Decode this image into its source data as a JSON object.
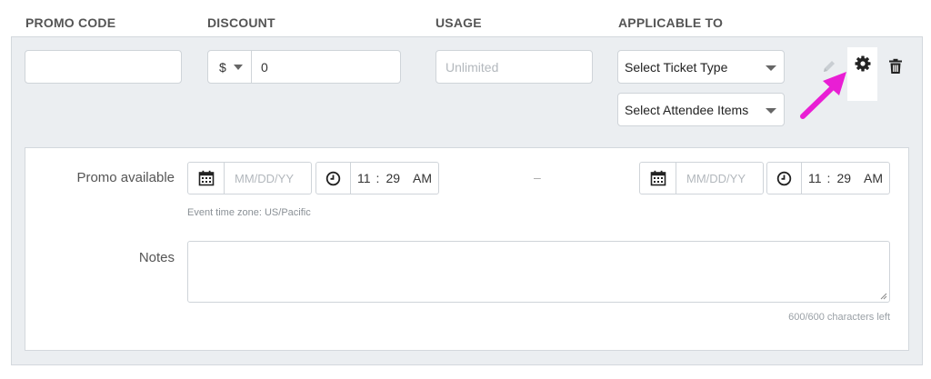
{
  "headers": {
    "promo_code": "PROMO CODE",
    "discount": "DISCOUNT",
    "usage": "USAGE",
    "applicable_to": "APPLICABLE TO"
  },
  "promo_code": {
    "value": ""
  },
  "discount": {
    "currency": "$",
    "amount": "0"
  },
  "usage": {
    "placeholder": "Unlimited"
  },
  "applicable": {
    "ticket_type": "Select Ticket Type",
    "attendee_items": "Select Attendee Items"
  },
  "promo_available": {
    "label": "Promo available",
    "start_date_placeholder": "MM/DD/YY",
    "start_hour": "11",
    "start_minute": "29",
    "start_ampm": "AM",
    "separator": "–",
    "end_date_placeholder": "MM/DD/YY",
    "end_hour": "11",
    "end_minute": "29",
    "end_ampm": "AM",
    "timezone_note": "Event time zone: US/Pacific"
  },
  "notes": {
    "label": "Notes",
    "value": "",
    "counter": "600/600 characters left"
  },
  "colors": {
    "panel_bg": "#ebeef1",
    "annotation_arrow": "#e91ed4"
  },
  "icons": [
    "pencil-icon",
    "gear-icon",
    "trash-icon",
    "calendar-icon",
    "clock-icon",
    "caret-down-icon"
  ]
}
